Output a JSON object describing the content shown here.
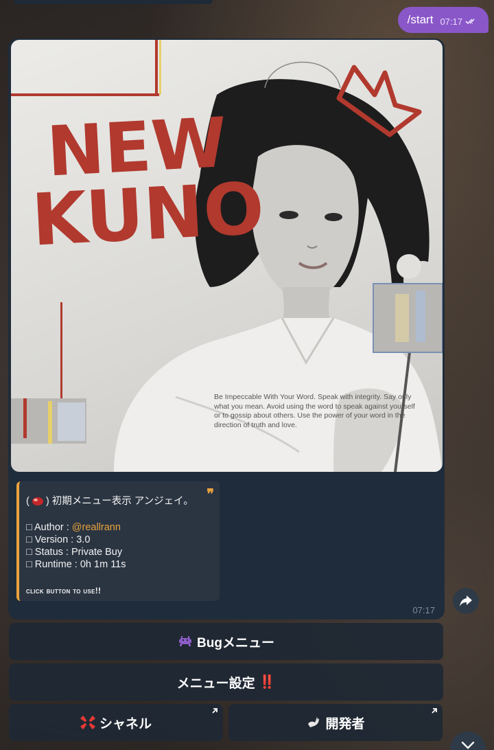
{
  "outgoing": {
    "text": "/start",
    "time": "07:17"
  },
  "poster": {
    "title_line1": "NEW",
    "title_line2": "KUNO",
    "quote": "Be Impeccable With Your Word. Speak with integrity. Say only what you mean. Avoid using the word to speak against yourself or to gossip about others. Use the power of your word in the direction of truth and love."
  },
  "quote_block": {
    "title_open": "(",
    "title_rest": ") 初期メニュー表示  アンジェイ。",
    "author_label": "□ Author : ",
    "author_value": "@reallrann",
    "version": "□ Version : 3.0",
    "status": "□ Status : Private Buy",
    "runtime": "□ Runtime : 0h 1m 11s",
    "click": "click button to use!!"
  },
  "message_time": "07:17",
  "keyboard": {
    "bug_menu": "Bugメニュー",
    "menu_settings": "メニュー設定",
    "menu_settings_mark": "‼️",
    "channel": "シャネル",
    "developer": "開発者"
  },
  "icons": [
    "double-check-icon",
    "quote-icon",
    "share-icon",
    "alien-monster-icon",
    "anger-icon",
    "dove-icon",
    "external-arrow-icon",
    "chevron-down-icon"
  ],
  "colors": {
    "outgoing_bubble": "#8a57c9",
    "incoming_bubble": "#1f2c3b",
    "accent": "#e9a23b",
    "poster_red": "#b1392e"
  }
}
